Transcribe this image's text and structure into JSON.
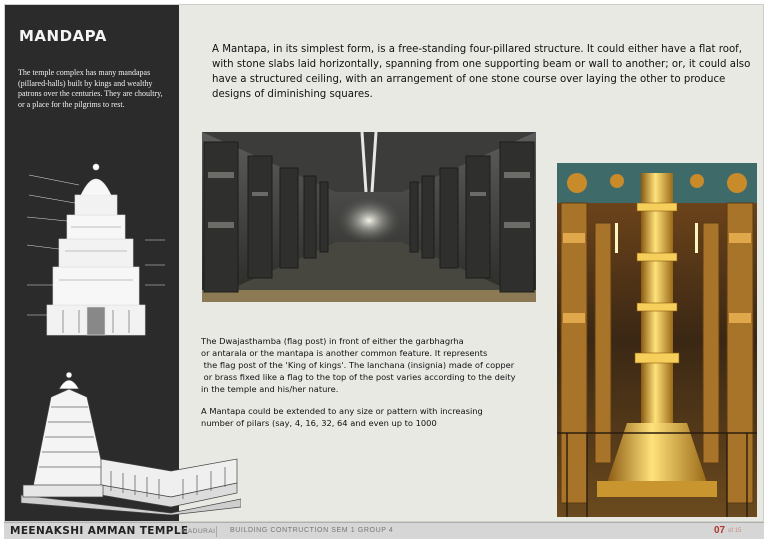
{
  "section": {
    "title": "MANDAPA"
  },
  "sidebar": {
    "intro": "The temple complex has many mandapas (pillared-halls) built by kings and wealthy patrons over the centuries. They are choultry, or a place for the pilgrims to rest."
  },
  "main": {
    "definition": "A Mantapa, in its simplest form, is a free-standing four-pillared structure. It could either have a flat roof, with stone slabs laid horizontally, spanning from one supporting beam or wall to another; or, it could also have a structured ceiling, with an arrangement of one stone course over laying the other to produce designs of diminishing squares.",
    "dwajasthamba_lines": [
      "The Dwajasthamba (flag post) in front of either the garbhagrha",
      "or antarala or the mantapa is another common feature. It represents",
      " the flag post of the 'King of kings'. The lanchana (insignia) made of copper",
      " or brass fixed like a flag to the top of the post varies according to the deity",
      "in the temple and his/her nature."
    ],
    "extension_lines": [
      "A Mantapa could be extended to any size or pattern with increasing",
      "number of pilars (say, 4, 16, 32, 64 and even up to 1000"
    ]
  },
  "footer": {
    "title": "MEENAKSHI AMMAN TEMPLE",
    "city": "MADURAI",
    "course": "BUILDING CONTRUCTION SEM 1 GROUP 4",
    "page_number": "07",
    "page_suffix": "of 15"
  },
  "colors": {
    "sidebar": "#2b2b2b",
    "page_bg": "#e9e9e4",
    "accent": "#b0372e",
    "gold": "#d7a43a"
  }
}
